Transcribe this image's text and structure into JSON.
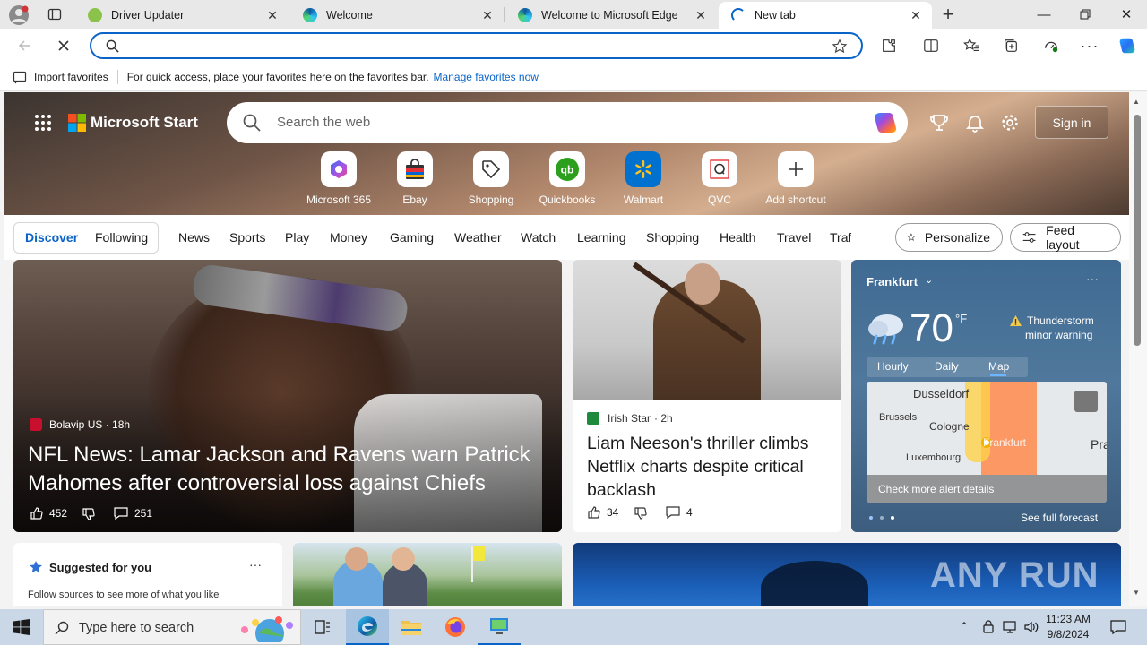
{
  "browser": {
    "tabs": [
      {
        "label": "Driver Updater"
      },
      {
        "label": "Welcome"
      },
      {
        "label": "Welcome to Microsoft Edge"
      },
      {
        "label": "New tab"
      }
    ],
    "favorites_bar": {
      "import_label": "Import favorites",
      "hint": "For quick access, place your favorites here on the favorites bar.",
      "manage_link": "Manage favorites now"
    }
  },
  "start": {
    "brand": "Microsoft Start",
    "search_placeholder": "Search the web",
    "sign_in": "Sign in",
    "shortcuts": [
      {
        "label": "Microsoft 365"
      },
      {
        "label": "Ebay"
      },
      {
        "label": "Shopping"
      },
      {
        "label": "Quickbooks"
      },
      {
        "label": "Walmart"
      },
      {
        "label": "QVC"
      },
      {
        "label": "Add shortcut"
      }
    ],
    "feed_tabs": {
      "discover": "Discover",
      "following": "Following"
    },
    "nav": [
      "News",
      "Sports",
      "Play",
      "Money",
      "Gaming",
      "Weather",
      "Watch",
      "Learning",
      "Shopping",
      "Health",
      "Travel",
      "Traf"
    ],
    "personalize": "Personalize",
    "feed_layout": "Feed layout"
  },
  "cards": {
    "main": {
      "source": "Bolavip US · 18h",
      "title": "NFL News: Lamar Jackson and Ravens warn Patrick Mahomes after controversial loss against Chiefs",
      "likes": "452",
      "comments": "251"
    },
    "second": {
      "source": "Irish Star",
      "time": "· 2h",
      "title": "Liam Neeson's thriller climbs Netflix charts despite critical backlash",
      "likes": "34",
      "comments": "4"
    },
    "weather": {
      "city": "Frankfurt",
      "temp": "70",
      "unit": "°F",
      "alert_line1": "Thunderstorm",
      "alert_line2": "minor warning",
      "tabs": [
        "Hourly",
        "Daily",
        "Map"
      ],
      "map_labels": [
        "Dusseldorf",
        "Brussels",
        "Cologne",
        "Frankfurt",
        "Luxembourg",
        "Prag"
      ],
      "alert_details": "Check more alert details",
      "forecast": "See full forecast"
    },
    "suggested": {
      "title": "Suggested for you",
      "text": "Follow sources to see more of what you like"
    }
  },
  "taskbar": {
    "search_placeholder": "Type here to search",
    "time": "11:23 AM",
    "date": "9/8/2024"
  },
  "watermark": "ANY RUN"
}
